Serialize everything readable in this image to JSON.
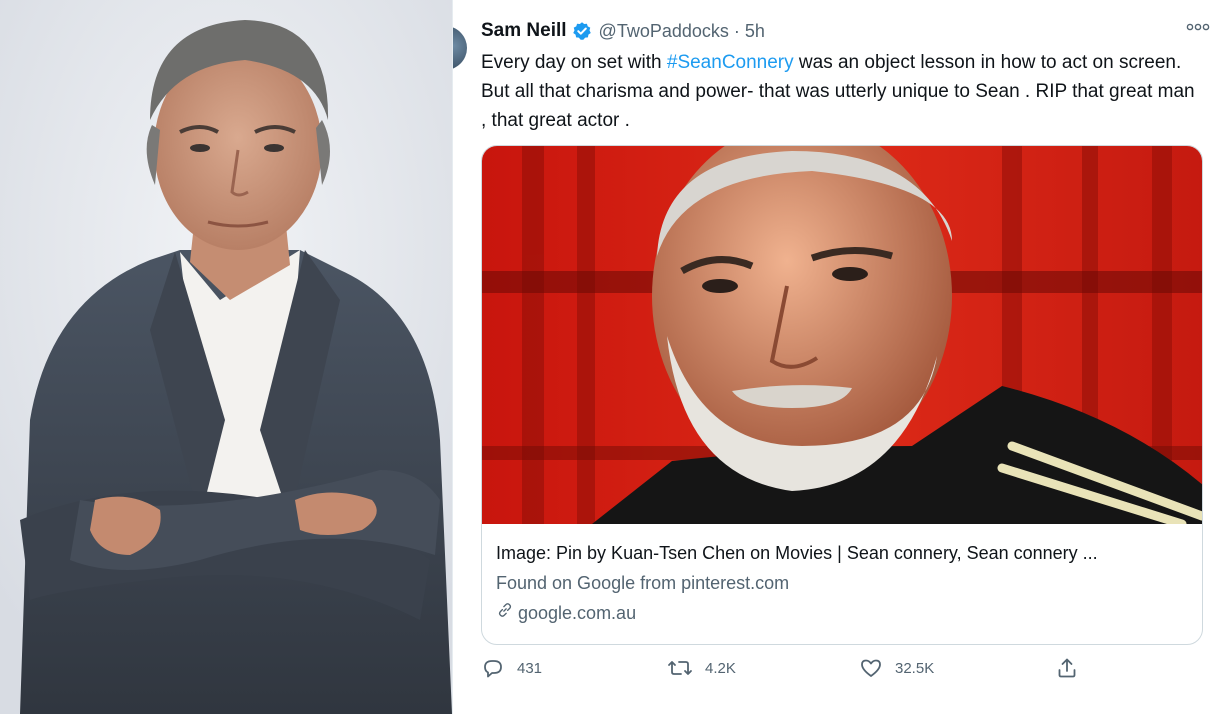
{
  "tweet": {
    "author_name": "Sam Neill",
    "handle": "@TwoPaddocks",
    "separator": "·",
    "time": "5h",
    "more_label": "ooo",
    "text_before": "Every day on set with ",
    "hashtag": "#SeanConnery",
    "text_after": " was an object lesson in how to act on screen.  But all that charisma and power- that was utterly unique to Sean . RIP that great man , that great actor .",
    "card": {
      "title": "Image: Pin by Kuan-Tsen Chen on Movies | Sean connery, Sean connery ...",
      "description": "Found on Google from pinterest.com",
      "domain": "google.com.au"
    },
    "stats": {
      "replies": "431",
      "retweets": "4.2K",
      "likes": "32.5K"
    }
  },
  "colors": {
    "accent": "#1d9bf0",
    "muted_text": "#536471",
    "card_background": "#d11d12"
  },
  "icons": [
    "verified-badge-icon",
    "more-icon",
    "link-icon",
    "reply-icon",
    "retweet-icon",
    "like-icon",
    "share-icon"
  ]
}
